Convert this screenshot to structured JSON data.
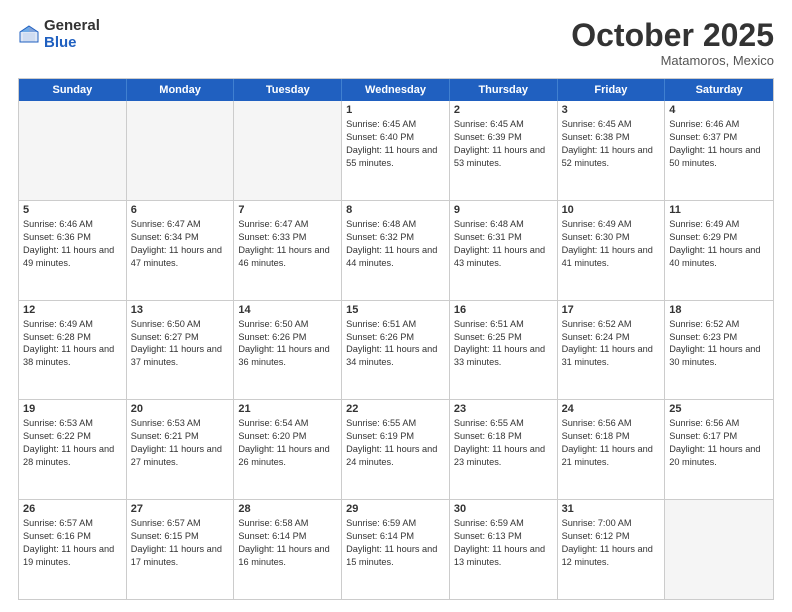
{
  "header": {
    "logo_general": "General",
    "logo_blue": "Blue",
    "month": "October 2025",
    "location": "Matamoros, Mexico"
  },
  "days_of_week": [
    "Sunday",
    "Monday",
    "Tuesday",
    "Wednesday",
    "Thursday",
    "Friday",
    "Saturday"
  ],
  "weeks": [
    [
      {
        "day": "",
        "empty": true
      },
      {
        "day": "",
        "empty": true
      },
      {
        "day": "",
        "empty": true
      },
      {
        "day": "1",
        "sunrise": "Sunrise: 6:45 AM",
        "sunset": "Sunset: 6:40 PM",
        "daylight": "Daylight: 11 hours and 55 minutes."
      },
      {
        "day": "2",
        "sunrise": "Sunrise: 6:45 AM",
        "sunset": "Sunset: 6:39 PM",
        "daylight": "Daylight: 11 hours and 53 minutes."
      },
      {
        "day": "3",
        "sunrise": "Sunrise: 6:45 AM",
        "sunset": "Sunset: 6:38 PM",
        "daylight": "Daylight: 11 hours and 52 minutes."
      },
      {
        "day": "4",
        "sunrise": "Sunrise: 6:46 AM",
        "sunset": "Sunset: 6:37 PM",
        "daylight": "Daylight: 11 hours and 50 minutes."
      }
    ],
    [
      {
        "day": "5",
        "sunrise": "Sunrise: 6:46 AM",
        "sunset": "Sunset: 6:36 PM",
        "daylight": "Daylight: 11 hours and 49 minutes."
      },
      {
        "day": "6",
        "sunrise": "Sunrise: 6:47 AM",
        "sunset": "Sunset: 6:34 PM",
        "daylight": "Daylight: 11 hours and 47 minutes."
      },
      {
        "day": "7",
        "sunrise": "Sunrise: 6:47 AM",
        "sunset": "Sunset: 6:33 PM",
        "daylight": "Daylight: 11 hours and 46 minutes."
      },
      {
        "day": "8",
        "sunrise": "Sunrise: 6:48 AM",
        "sunset": "Sunset: 6:32 PM",
        "daylight": "Daylight: 11 hours and 44 minutes."
      },
      {
        "day": "9",
        "sunrise": "Sunrise: 6:48 AM",
        "sunset": "Sunset: 6:31 PM",
        "daylight": "Daylight: 11 hours and 43 minutes."
      },
      {
        "day": "10",
        "sunrise": "Sunrise: 6:49 AM",
        "sunset": "Sunset: 6:30 PM",
        "daylight": "Daylight: 11 hours and 41 minutes."
      },
      {
        "day": "11",
        "sunrise": "Sunrise: 6:49 AM",
        "sunset": "Sunset: 6:29 PM",
        "daylight": "Daylight: 11 hours and 40 minutes."
      }
    ],
    [
      {
        "day": "12",
        "sunrise": "Sunrise: 6:49 AM",
        "sunset": "Sunset: 6:28 PM",
        "daylight": "Daylight: 11 hours and 38 minutes."
      },
      {
        "day": "13",
        "sunrise": "Sunrise: 6:50 AM",
        "sunset": "Sunset: 6:27 PM",
        "daylight": "Daylight: 11 hours and 37 minutes."
      },
      {
        "day": "14",
        "sunrise": "Sunrise: 6:50 AM",
        "sunset": "Sunset: 6:26 PM",
        "daylight": "Daylight: 11 hours and 36 minutes."
      },
      {
        "day": "15",
        "sunrise": "Sunrise: 6:51 AM",
        "sunset": "Sunset: 6:26 PM",
        "daylight": "Daylight: 11 hours and 34 minutes."
      },
      {
        "day": "16",
        "sunrise": "Sunrise: 6:51 AM",
        "sunset": "Sunset: 6:25 PM",
        "daylight": "Daylight: 11 hours and 33 minutes."
      },
      {
        "day": "17",
        "sunrise": "Sunrise: 6:52 AM",
        "sunset": "Sunset: 6:24 PM",
        "daylight": "Daylight: 11 hours and 31 minutes."
      },
      {
        "day": "18",
        "sunrise": "Sunrise: 6:52 AM",
        "sunset": "Sunset: 6:23 PM",
        "daylight": "Daylight: 11 hours and 30 minutes."
      }
    ],
    [
      {
        "day": "19",
        "sunrise": "Sunrise: 6:53 AM",
        "sunset": "Sunset: 6:22 PM",
        "daylight": "Daylight: 11 hours and 28 minutes."
      },
      {
        "day": "20",
        "sunrise": "Sunrise: 6:53 AM",
        "sunset": "Sunset: 6:21 PM",
        "daylight": "Daylight: 11 hours and 27 minutes."
      },
      {
        "day": "21",
        "sunrise": "Sunrise: 6:54 AM",
        "sunset": "Sunset: 6:20 PM",
        "daylight": "Daylight: 11 hours and 26 minutes."
      },
      {
        "day": "22",
        "sunrise": "Sunrise: 6:55 AM",
        "sunset": "Sunset: 6:19 PM",
        "daylight": "Daylight: 11 hours and 24 minutes."
      },
      {
        "day": "23",
        "sunrise": "Sunrise: 6:55 AM",
        "sunset": "Sunset: 6:18 PM",
        "daylight": "Daylight: 11 hours and 23 minutes."
      },
      {
        "day": "24",
        "sunrise": "Sunrise: 6:56 AM",
        "sunset": "Sunset: 6:18 PM",
        "daylight": "Daylight: 11 hours and 21 minutes."
      },
      {
        "day": "25",
        "sunrise": "Sunrise: 6:56 AM",
        "sunset": "Sunset: 6:17 PM",
        "daylight": "Daylight: 11 hours and 20 minutes."
      }
    ],
    [
      {
        "day": "26",
        "sunrise": "Sunrise: 6:57 AM",
        "sunset": "Sunset: 6:16 PM",
        "daylight": "Daylight: 11 hours and 19 minutes."
      },
      {
        "day": "27",
        "sunrise": "Sunrise: 6:57 AM",
        "sunset": "Sunset: 6:15 PM",
        "daylight": "Daylight: 11 hours and 17 minutes."
      },
      {
        "day": "28",
        "sunrise": "Sunrise: 6:58 AM",
        "sunset": "Sunset: 6:14 PM",
        "daylight": "Daylight: 11 hours and 16 minutes."
      },
      {
        "day": "29",
        "sunrise": "Sunrise: 6:59 AM",
        "sunset": "Sunset: 6:14 PM",
        "daylight": "Daylight: 11 hours and 15 minutes."
      },
      {
        "day": "30",
        "sunrise": "Sunrise: 6:59 AM",
        "sunset": "Sunset: 6:13 PM",
        "daylight": "Daylight: 11 hours and 13 minutes."
      },
      {
        "day": "31",
        "sunrise": "Sunrise: 7:00 AM",
        "sunset": "Sunset: 6:12 PM",
        "daylight": "Daylight: 11 hours and 12 minutes."
      },
      {
        "day": "",
        "empty": true
      }
    ]
  ]
}
